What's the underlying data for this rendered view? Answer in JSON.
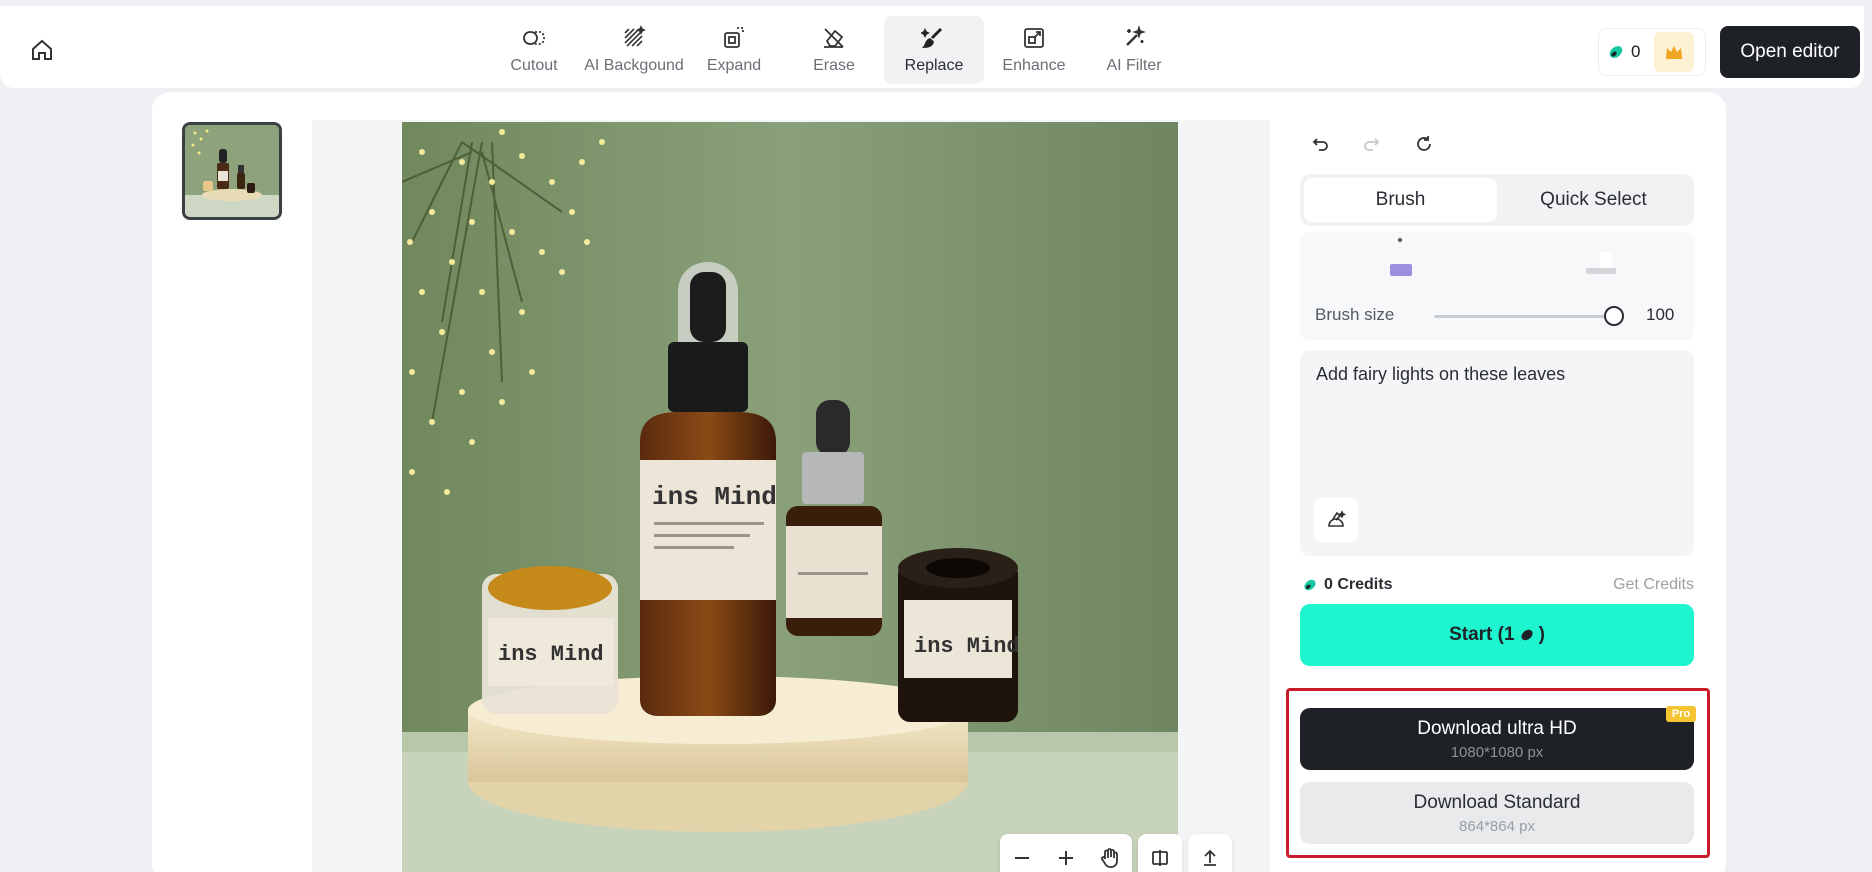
{
  "toolbar": {
    "tools": [
      {
        "label": "Cutout",
        "icon": "cutout-icon"
      },
      {
        "label": "AI Backgound",
        "icon": "ai-background-icon"
      },
      {
        "label": "Expand",
        "icon": "expand-icon"
      },
      {
        "label": "Erase",
        "icon": "erase-icon"
      },
      {
        "label": "Replace",
        "icon": "replace-icon",
        "active": true
      },
      {
        "label": "Enhance",
        "icon": "enhance-icon"
      },
      {
        "label": "AI Filter",
        "icon": "ai-filter-icon"
      }
    ],
    "credit_count": "0",
    "open_editor_label": "Open editor"
  },
  "image": {
    "brand_text": "ins Mind"
  },
  "right_panel": {
    "mode_tabs": [
      "Brush",
      "Quick Select"
    ],
    "active_mode": "Brush",
    "brush_size_label": "Brush size",
    "brush_size_value": "100",
    "prompt_text": "Add fairy lights on these leaves",
    "credits_label": "0 Credits",
    "get_credits_label": "Get Credits",
    "start_label": "Start (1",
    "start_suffix": ")",
    "download_hd": {
      "title": "Download ultra HD",
      "size": "1080*1080 px",
      "badge": "Pro"
    },
    "download_standard": {
      "title": "Download Standard",
      "size": "864*864 px"
    }
  },
  "colors": {
    "accent": "#1ef5cf",
    "dark": "#1e2227",
    "highlight_border": "#c81c2a",
    "pro_badge": "#f5c431"
  }
}
